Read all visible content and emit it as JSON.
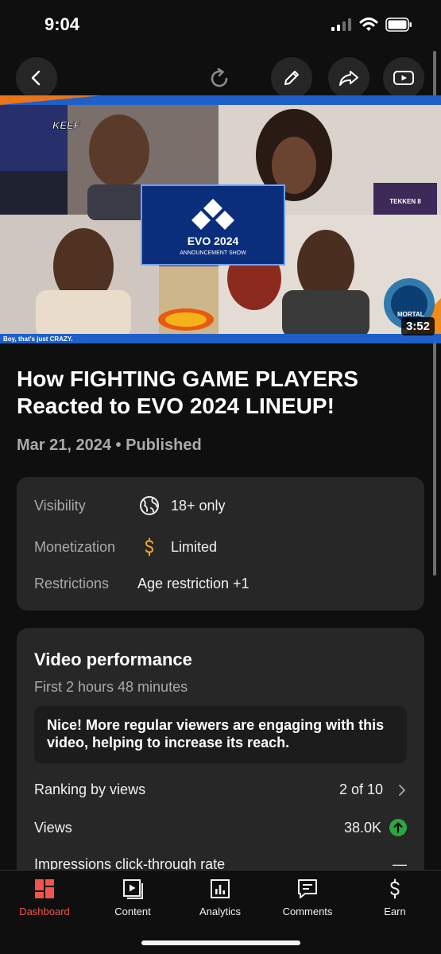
{
  "status_bar": {
    "time": "9:04"
  },
  "toolbar": {
    "icons": [
      "back-icon",
      "refresh-icon",
      "edit-icon",
      "share-icon",
      "youtube-icon"
    ]
  },
  "video": {
    "thumbnail_texts": {
      "evo_title": "EVO 2024",
      "evo_subtitle": "ANNOUNCEMENT SHOW",
      "keef": "KEEF",
      "tekken": "TEKKEN 8",
      "mortal": "MORTAL",
      "caption": "Boy, that's just CRAZY."
    },
    "duration": "3:52",
    "title": "How FIGHTING GAME PLAYERS Reacted to EVO 2024 LINEUP!",
    "date": "Mar 21, 2024",
    "separator": "•",
    "status": "Published"
  },
  "details": {
    "visibility": {
      "label": "Visibility",
      "value": "18+ only",
      "icon": "globe-icon"
    },
    "monetization": {
      "label": "Monetization",
      "value": "Limited",
      "icon": "dollar-icon",
      "icon_color": "#f5a623"
    },
    "restrictions": {
      "label": "Restrictions",
      "value": "Age restriction +1"
    }
  },
  "performance": {
    "title": "Video performance",
    "subtitle": "First 2 hours 48 minutes",
    "notice": "Nice! More regular viewers are engaging with this video, helping to increase its reach.",
    "metrics": [
      {
        "label": "Ranking by views",
        "value": "2 of 10",
        "indicator": "chevron-right-icon"
      },
      {
        "label": "Views",
        "value": "38.0K",
        "indicator": "up-arrow-icon",
        "indicator_color": "#2ba640"
      },
      {
        "label": "Impressions click-through rate",
        "value": "—"
      }
    ]
  },
  "bottom_nav": [
    {
      "label": "Dashboard",
      "icon": "dashboard-icon",
      "active": true
    },
    {
      "label": "Content",
      "icon": "content-icon",
      "active": false
    },
    {
      "label": "Analytics",
      "icon": "analytics-icon",
      "active": false
    },
    {
      "label": "Comments",
      "icon": "comments-icon",
      "active": false
    },
    {
      "label": "Earn",
      "icon": "earn-icon",
      "active": false
    }
  ],
  "colors": {
    "accent": "#f2544a",
    "background": "#0f0f0f",
    "card": "#272727",
    "positive": "#2ba640",
    "monetization": "#f5a623"
  }
}
